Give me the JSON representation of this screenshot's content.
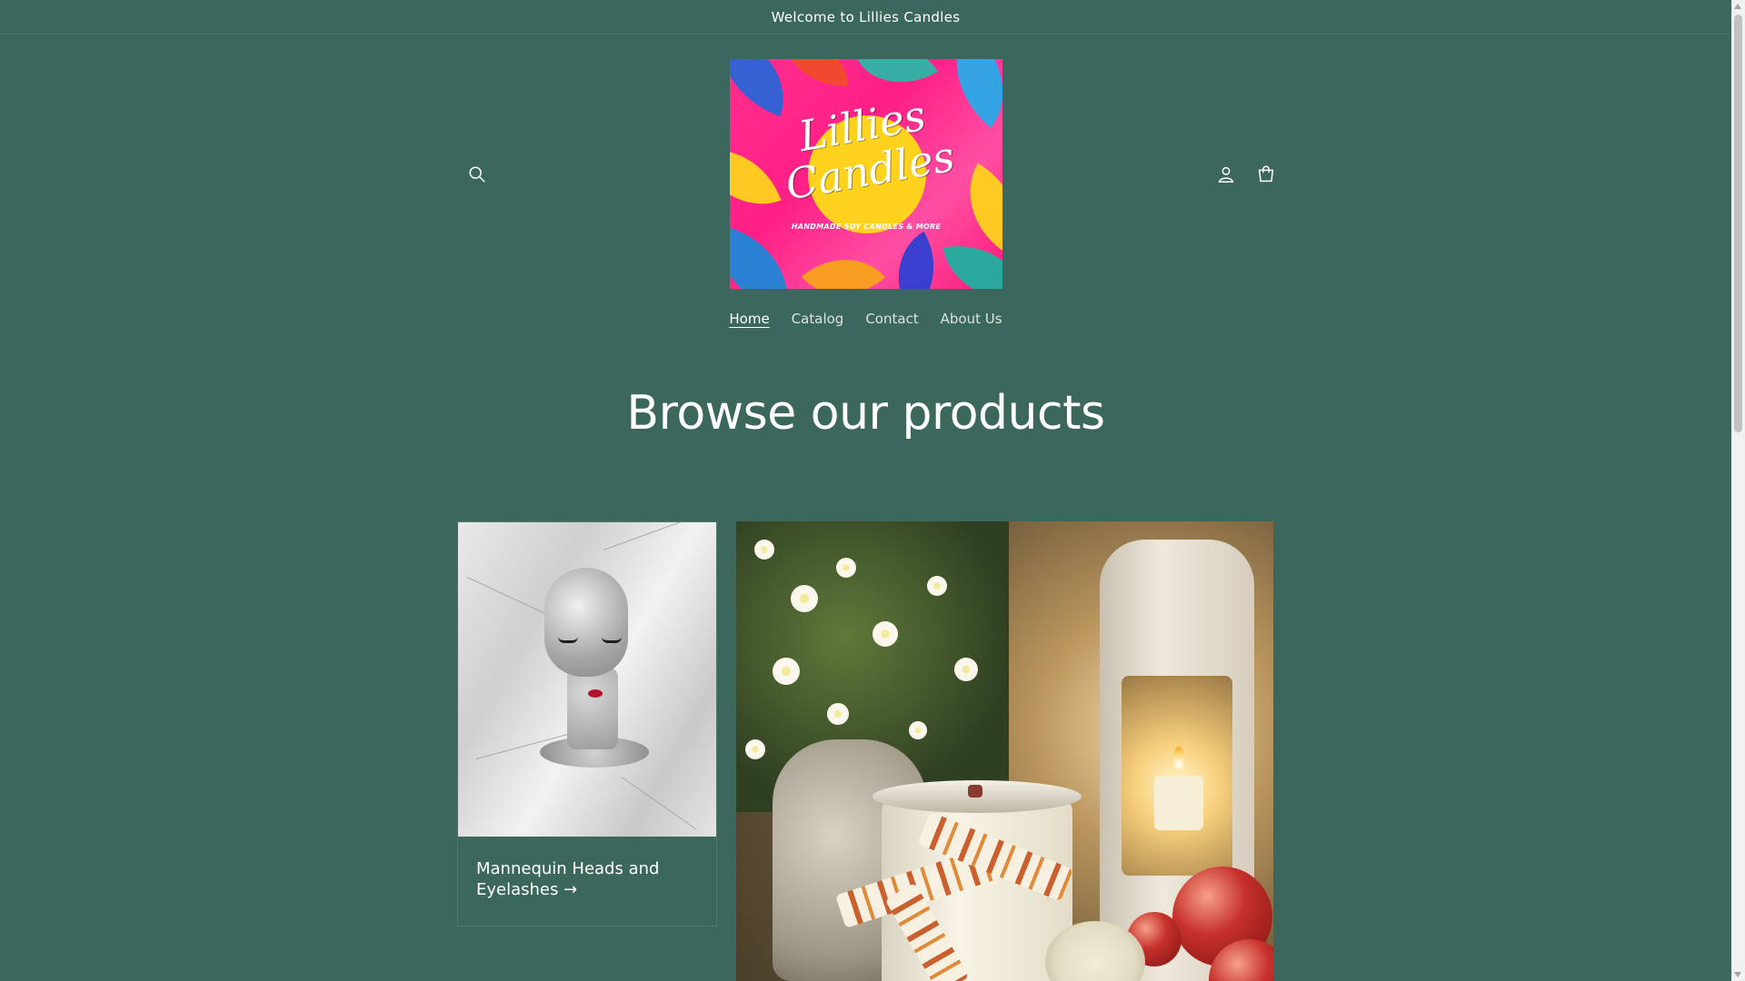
{
  "announcement": {
    "text": "Welcome to Lillies Candles"
  },
  "header": {
    "logo": {
      "title": "Lillies\nCandles",
      "tagline": "HANDMADE SOY CANDLES & MORE",
      "colors": {
        "background": "#ff2f8e",
        "sun": "#ffd21e"
      }
    },
    "icons": {
      "search": "search-icon",
      "account": "account-icon",
      "cart": "cart-icon"
    }
  },
  "nav": {
    "items": [
      {
        "label": "Home",
        "active": true
      },
      {
        "label": "Catalog",
        "active": false
      },
      {
        "label": "Contact",
        "active": false
      },
      {
        "label": "About Us",
        "active": false
      }
    ]
  },
  "main": {
    "heading": "Browse our products",
    "collections": [
      {
        "title": "Mannequin Heads and Eyelashes",
        "arrow": "→"
      }
    ]
  },
  "colors": {
    "page_background": "#3c675c",
    "text": "#ffffff"
  }
}
